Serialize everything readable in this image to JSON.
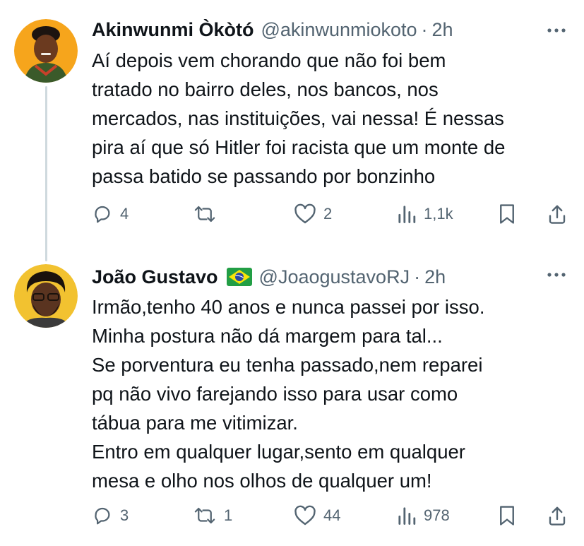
{
  "tweets": [
    {
      "name": "Akinwunmi Òkòtó",
      "handle": "@akinwunmiokoto",
      "separator": "·",
      "time": "2h",
      "text": "Aí depois vem chorando que não foi bem\ntratado no bairro deles, nos bancos, nos\nmercados, nas instituições, vai nessa! É nessas\npira aí que só Hitler foi racista que um monte de\npassa batido se passando por bonzinho",
      "replies": "4",
      "retweets": "",
      "likes": "2",
      "views": "1,1k",
      "avatar_bg": "#f6a51c"
    },
    {
      "name": "João Gustavo",
      "flag_icon": "brazil-flag-icon",
      "handle": "@JoaogustavoRJ",
      "separator": "·",
      "time": "2h",
      "text": "Irmão,tenho 40 anos e nunca passei por isso.\nMinha postura não dá margem para tal...\nSe porventura eu tenha passado,nem reparei\npq não vivo farejando isso para usar como\ntábua para me vitimizar.\nEntro em qualquer lugar,sento em qualquer\nmesa e olho nos olhos de qualquer um!",
      "replies": "3",
      "retweets": "1",
      "likes": "44",
      "views": "978",
      "avatar_bg": "#f2c230"
    }
  ],
  "colors": {
    "text": "#0f1419",
    "secondary": "#536471",
    "thread_line": "#cfd9de"
  }
}
